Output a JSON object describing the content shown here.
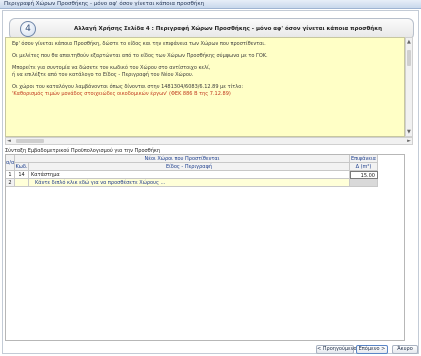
{
  "window": {
    "title": "Περιγραφή Χώρων Προσθήκης - μόνο αφ' όσον γίνεται κάποια προσθήκη"
  },
  "step": {
    "number": "4",
    "title": "Αλλαγή Χρήσης Σελίδα 4 : Περιγραφή Χώρων Προσθήκης - μόνο αφ' όσον γίνεται κάποια προσθήκη"
  },
  "info": {
    "lines": [
      "Εφ' όσον γίνεται κάποια Προσθήκη, δώστε το είδος και την επιφάνεια των Χώρων που προστίθενται.",
      "Οι μελέτες που θα απαιτηθούν εξαρτώνται από το είδος των Χώρων Προσθήκης σύμφωνα με το ΓΟΚ.",
      "Μπορείτε για συντομία να δώσετε τον κωδικό του Χώρου στο αντίστοιχο κελί,",
      "ή να επιλέξτε από τον κατάλογο το Είδος - Περιγραφή του Νέου Χώρου.",
      "Οι χώροι του καταλόγου λαμβάνονται όπως δίνονται στην 1481304/6083/6.12.89 με τίτλο:",
      "'Καθορισμός τιμών μονάδος στοιχειώδες οικοδομικών έργων' (ΦΕΚ 886 Β της 7.12.89)"
    ]
  },
  "table": {
    "caption": "Σύνταξη Εμβαδομετρικού Προϋπολογισμού για την Προσθήκη",
    "headers": {
      "ao": "α/α",
      "group": "Νέοι Χώροι που Προστίθενται",
      "code": "Κωδ.",
      "desc": "Είδος - Περιγραφή",
      "area_top": "Επιφάνεια",
      "area_bottom": "Δ (m²)"
    },
    "rows": [
      {
        "ao": "1",
        "code": "14",
        "desc": "Κατάστημα",
        "area": "15.00"
      },
      {
        "ao": "2",
        "code": "",
        "desc": "Κάντε διπλό κλικ εδώ για να προσθέσετε Χώρους ...",
        "area": ""
      }
    ]
  },
  "buttons": {
    "prev": "< Προηγούμενο",
    "next": "Επόμενο >",
    "cancel": "Άκυρο"
  }
}
